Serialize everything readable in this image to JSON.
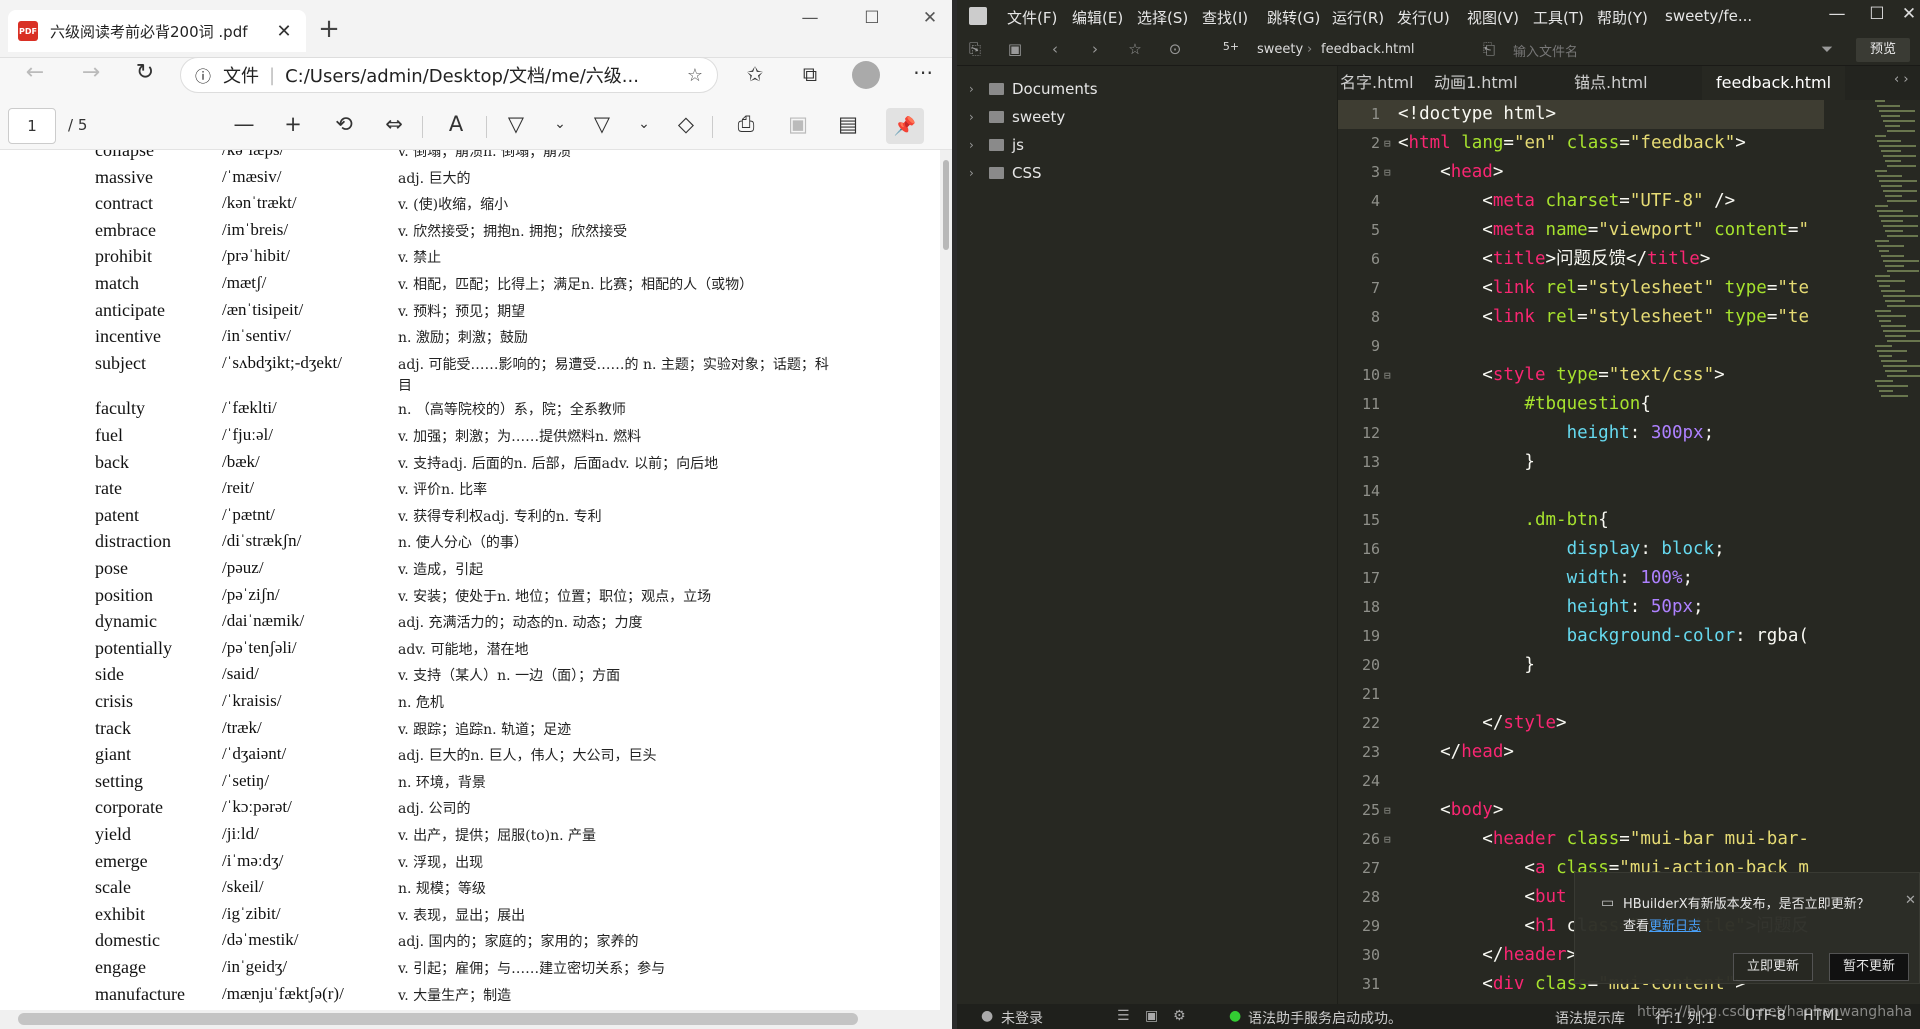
{
  "browser": {
    "tab_title": "六级阅读考前必背200词 .pdf",
    "pdf_icon_label": "PDF",
    "new_tab": "+",
    "address_prefix": "文件",
    "address": "C:/Users/admin/Desktop/文档/me/六级...",
    "page_current": "1",
    "page_total": "/ 5"
  },
  "vocab": [
    {
      "word": "collapse",
      "phonetic": "/kəˈlæps/",
      "def": "v. 倒塌；崩溃n. 倒塌；崩溃"
    },
    {
      "word": "massive",
      "phonetic": "/ˈmæsiv/",
      "def": "adj. 巨大的"
    },
    {
      "word": "contract",
      "phonetic": "/kənˈtrækt/",
      "def": "v. (使)收缩，缩小"
    },
    {
      "word": "embrace",
      "phonetic": "/imˈbreis/",
      "def": "v. 欣然接受；拥抱n. 拥抱；欣然接受"
    },
    {
      "word": "prohibit",
      "phonetic": "/prəˈhibit/",
      "def": "v. 禁止"
    },
    {
      "word": "match",
      "phonetic": "/mætʃ/",
      "def": "v. 相配，匹配；比得上；满足n. 比赛；相配的人（或物）"
    },
    {
      "word": "anticipate",
      "phonetic": "/ænˈtisipeit/",
      "def": "v. 预料；预见；期望"
    },
    {
      "word": "incentive",
      "phonetic": "/inˈsentiv/",
      "def": "n. 激励；刺激；鼓励"
    },
    {
      "word": "subject",
      "phonetic": "/ˈsʌbdʒikt;-dʒekt/",
      "def": "adj. 可能受……影响的；易遭受……的 n. 主题；实验对象；话题；科目"
    },
    {
      "word": "faculty",
      "phonetic": "/ˈfækltі/",
      "def": "n. （高等院校的）系，院；全系教师"
    },
    {
      "word": "fuel",
      "phonetic": "/ˈfjuːəl/",
      "def": "v. 加强；刺激；为……提供燃料n. 燃料"
    },
    {
      "word": "back",
      "phonetic": "/bæk/",
      "def": "v. 支持adj. 后面的n. 后部，后面adv. 以前；向后地"
    },
    {
      "word": "rate",
      "phonetic": "/reit/",
      "def": "v. 评价n.  比率"
    },
    {
      "word": "patent",
      "phonetic": "/ˈpætnt/",
      "def": "v. 获得专利权adj. 专利的n. 专利"
    },
    {
      "word": "distraction",
      "phonetic": "/diˈstrækʃn/",
      "def": "n. 使人分心（的事）"
    },
    {
      "word": "pose",
      "phonetic": "/pəuz/",
      "def": "v. 造成，引起"
    },
    {
      "word": "position",
      "phonetic": "/pəˈziʃn/",
      "def": "v. 安装；使处于n. 地位；位置；职位；观点，立场"
    },
    {
      "word": "dynamic",
      "phonetic": "/daiˈnæmik/",
      "def": "adj. 充满活力的；动态的n. 动态；力度"
    },
    {
      "word": "potentially",
      "phonetic": "/pəˈtenʃəli/",
      "def": "adv. 可能地，潜在地"
    },
    {
      "word": "side",
      "phonetic": "/said/",
      "def": "v. 支持（某人）n. 一边（面）；方面"
    },
    {
      "word": "crisis",
      "phonetic": "/ˈkraisis/",
      "def": "n. 危机"
    },
    {
      "word": "track",
      "phonetic": "/træk/",
      "def": "v. 跟踪；追踪n. 轨道；足迹"
    },
    {
      "word": "giant",
      "phonetic": "/ˈdʒaiənt/",
      "def": "adj. 巨大的n. 巨人，伟人；大公司，巨头"
    },
    {
      "word": "setting",
      "phonetic": "/ˈsetiŋ/",
      "def": "n. 环境，背景"
    },
    {
      "word": "corporate",
      "phonetic": "/ˈkɔːpərət/",
      "def": "adj. 公司的"
    },
    {
      "word": "yield",
      "phonetic": "/jiːld/",
      "def": "v. 出产，提供；屈服(to)n. 产量"
    },
    {
      "word": "emerge",
      "phonetic": "/iˈməːdʒ/",
      "def": "v. 浮现，出现"
    },
    {
      "word": "scale",
      "phonetic": "/skeil/",
      "def": "n. 规模；等级"
    },
    {
      "word": "exhibit",
      "phonetic": "/igˈzibit/",
      "def": "v. 表现，显出；展出"
    },
    {
      "word": "domestic",
      "phonetic": "/dəˈmestik/",
      "def": "adj. 国内的；家庭的；家用的；家养的"
    },
    {
      "word": "engage",
      "phonetic": "/inˈgeidʒ/",
      "def": "v. 引起；雇佣；与……建立密切关系；参与"
    },
    {
      "word": "manufacture",
      "phonetic": "/mænjuˈfæktʃə(r)/",
      "def": "v. 大量生产；制造"
    }
  ],
  "editor": {
    "menus": [
      "文件(F)",
      "编辑(E)",
      "选择(S)",
      "查找(I)",
      "跳转(G)",
      "运行(R)",
      "发行(U)",
      "视图(V)",
      "工具(T)",
      "帮助(Y)",
      "sweety/fe..."
    ],
    "breadcrumb": [
      "sweety",
      "feedback.html"
    ],
    "file_input_placeholder": "输入文件名",
    "preview": "预览",
    "tree": [
      "Documents",
      "sweety",
      "js",
      "CSS"
    ],
    "tabs": [
      "名字.html",
      "动画1.html",
      "锚点.html",
      "feedback.html"
    ],
    "notify_text": "HBuilderX有新版本发布，是否立即更新？",
    "notify_sub": "查看",
    "notify_link": "更新日志",
    "notify_update": "立即更新",
    "notify_later": "暂不更新",
    "status": {
      "login": "未登录",
      "message": "语法助手服务启动成功。",
      "hint": "语法提示库",
      "pos": "行:1  列:1",
      "enc": "UTF-8",
      "lang": "HTML",
      "watermark": "https://blog.csdn.net/hanhanwanghaha"
    }
  },
  "code_lines": [
    [
      [
        "t-w",
        "<!doctype html>"
      ]
    ],
    [
      [
        "t-w",
        "<"
      ],
      [
        "t-tag",
        "html"
      ],
      [
        "t-w",
        " "
      ],
      [
        "t-attr",
        "lang"
      ],
      [
        "t-w",
        "="
      ],
      [
        "t-str",
        "\"en\""
      ],
      [
        "t-w",
        " "
      ],
      [
        "t-attr",
        "class"
      ],
      [
        "t-w",
        "="
      ],
      [
        "t-str",
        "\"feedback\""
      ],
      [
        "t-w",
        ">"
      ]
    ],
    [
      [
        "t-w",
        "    <"
      ],
      [
        "t-tag",
        "head"
      ],
      [
        "t-w",
        ">"
      ]
    ],
    [
      [
        "t-w",
        "        <"
      ],
      [
        "t-tag",
        "meta"
      ],
      [
        "t-w",
        " "
      ],
      [
        "t-attr",
        "charset"
      ],
      [
        "t-w",
        "="
      ],
      [
        "t-str",
        "\"UTF-8\""
      ],
      [
        "t-w",
        " />"
      ]
    ],
    [
      [
        "t-w",
        "        <"
      ],
      [
        "t-tag",
        "meta"
      ],
      [
        "t-w",
        " "
      ],
      [
        "t-attr",
        "name"
      ],
      [
        "t-w",
        "="
      ],
      [
        "t-str",
        "\"viewport\""
      ],
      [
        "t-w",
        " "
      ],
      [
        "t-attr",
        "content"
      ],
      [
        "t-w",
        "="
      ],
      [
        "t-str",
        "\""
      ]
    ],
    [
      [
        "t-w",
        "        <"
      ],
      [
        "t-tag",
        "title"
      ],
      [
        "t-w",
        ">问题反馈</"
      ],
      [
        "t-tag",
        "title"
      ],
      [
        "t-w",
        ">"
      ]
    ],
    [
      [
        "t-w",
        "        <"
      ],
      [
        "t-tag",
        "link"
      ],
      [
        "t-w",
        " "
      ],
      [
        "t-attr",
        "rel"
      ],
      [
        "t-w",
        "="
      ],
      [
        "t-str",
        "\"stylesheet\""
      ],
      [
        "t-w",
        " "
      ],
      [
        "t-attr",
        "type"
      ],
      [
        "t-w",
        "="
      ],
      [
        "t-str",
        "\"te"
      ]
    ],
    [
      [
        "t-w",
        "        <"
      ],
      [
        "t-tag",
        "link"
      ],
      [
        "t-w",
        " "
      ],
      [
        "t-attr",
        "rel"
      ],
      [
        "t-w",
        "="
      ],
      [
        "t-str",
        "\"stylesheet\""
      ],
      [
        "t-w",
        " "
      ],
      [
        "t-attr",
        "type"
      ],
      [
        "t-w",
        "="
      ],
      [
        "t-str",
        "\"te"
      ]
    ],
    [],
    [
      [
        "t-w",
        "        <"
      ],
      [
        "t-tag",
        "style"
      ],
      [
        "t-w",
        " "
      ],
      [
        "t-attr",
        "type"
      ],
      [
        "t-w",
        "="
      ],
      [
        "t-str",
        "\"text/css\""
      ],
      [
        "t-w",
        ">"
      ]
    ],
    [
      [
        "t-w",
        "            "
      ],
      [
        "t-sel",
        "#tbquestion"
      ],
      [
        "t-w",
        "{"
      ]
    ],
    [
      [
        "t-w",
        "                "
      ],
      [
        "t-prop",
        "height"
      ],
      [
        "t-w",
        ": "
      ],
      [
        "t-num",
        "300px"
      ],
      [
        "t-w",
        ";"
      ]
    ],
    [
      [
        "t-w",
        "            }"
      ]
    ],
    [],
    [
      [
        "t-w",
        "            "
      ],
      [
        "t-sel",
        ".dm-btn"
      ],
      [
        "t-w",
        "{"
      ]
    ],
    [
      [
        "t-w",
        "                "
      ],
      [
        "t-prop",
        "display"
      ],
      [
        "t-w",
        ": "
      ],
      [
        "t-prop",
        "block"
      ],
      [
        "t-w",
        ";"
      ]
    ],
    [
      [
        "t-w",
        "                "
      ],
      [
        "t-prop",
        "width"
      ],
      [
        "t-w",
        ": "
      ],
      [
        "t-num",
        "100%"
      ],
      [
        "t-w",
        ";"
      ]
    ],
    [
      [
        "t-w",
        "                "
      ],
      [
        "t-prop",
        "height"
      ],
      [
        "t-w",
        ": "
      ],
      [
        "t-num",
        "50px"
      ],
      [
        "t-w",
        ";"
      ]
    ],
    [
      [
        "t-w",
        "                "
      ],
      [
        "t-prop",
        "background-color"
      ],
      [
        "t-w",
        ": "
      ],
      [
        "t-w",
        "rgba("
      ]
    ],
    [
      [
        "t-w",
        "            }"
      ]
    ],
    [],
    [
      [
        "t-w",
        "        </"
      ],
      [
        "t-tag",
        "style"
      ],
      [
        "t-w",
        ">"
      ]
    ],
    [
      [
        "t-w",
        "    </"
      ],
      [
        "t-tag",
        "head"
      ],
      [
        "t-w",
        ">"
      ]
    ],
    [],
    [
      [
        "t-w",
        "    <"
      ],
      [
        "t-tag",
        "body"
      ],
      [
        "t-w",
        ">"
      ]
    ],
    [
      [
        "t-w",
        "        <"
      ],
      [
        "t-tag",
        "header"
      ],
      [
        "t-w",
        " "
      ],
      [
        "t-attr",
        "class"
      ],
      [
        "t-w",
        "="
      ],
      [
        "t-str",
        "\"mui-bar mui-bar-"
      ]
    ],
    [
      [
        "t-w",
        "            <"
      ],
      [
        "t-tag",
        "a"
      ],
      [
        "t-w",
        " "
      ],
      [
        "t-attr",
        "class"
      ],
      [
        "t-w",
        "="
      ],
      [
        "t-str",
        "\"mui-action-back m"
      ]
    ],
    [
      [
        "t-w",
        "            <"
      ],
      [
        "t-tag",
        "but"
      ]
    ],
    [
      [
        "t-w",
        "            <"
      ],
      [
        "t-tag",
        "h1"
      ],
      [
        "t-w",
        " cl"
      ],
      [
        "t-str",
        "ass=\"mui-title\""
      ],
      [
        "t-w",
        ">问题反"
      ]
    ],
    [
      [
        "t-w",
        "        </"
      ],
      [
        "t-tag",
        "header"
      ],
      [
        "t-w",
        ">"
      ]
    ],
    [
      [
        "t-w",
        "        <"
      ],
      [
        "t-tag",
        "div"
      ],
      [
        "t-w",
        " "
      ],
      [
        "t-attr",
        "class"
      ],
      [
        "t-w",
        "="
      ],
      [
        "t-str",
        "\"mui-content\""
      ],
      [
        "t-w",
        ">"
      ]
    ]
  ]
}
